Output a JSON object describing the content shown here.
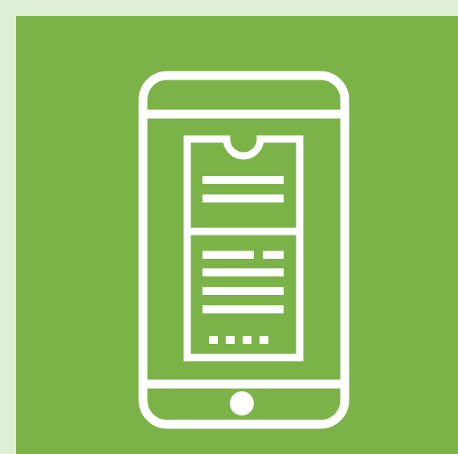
{
  "colors": {
    "page_background": "#dfeed6",
    "panel_background": "#7cb348",
    "icon_stroke": "#ffffff"
  },
  "icon": "mobile-ticket-icon"
}
